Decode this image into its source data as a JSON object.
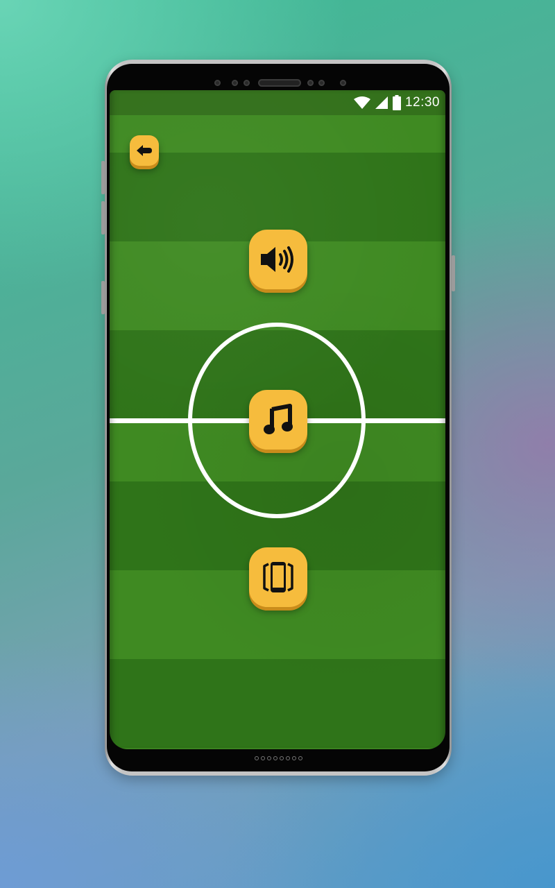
{
  "device": {
    "status_bar": {
      "time": "12:30",
      "icons": [
        "wifi-icon",
        "cellular-signal-icon",
        "battery-icon"
      ]
    }
  },
  "screen": {
    "background": "soccer-field",
    "buttons": [
      {
        "name": "back-button",
        "icon": "back-arrow-icon"
      },
      {
        "name": "sound-toggle-button",
        "icon": "speaker-volume-icon"
      },
      {
        "name": "music-toggle-button",
        "icon": "music-note-icon"
      },
      {
        "name": "vibration-toggle-button",
        "icon": "phone-vibrate-icon"
      }
    ]
  },
  "colors": {
    "button_yellow": "#f6bc3d",
    "button_shadow": "#c98c1b",
    "grass_light": "#3f8a22",
    "grass_dark": "#2f7419",
    "field_lines": "#ffffff"
  }
}
